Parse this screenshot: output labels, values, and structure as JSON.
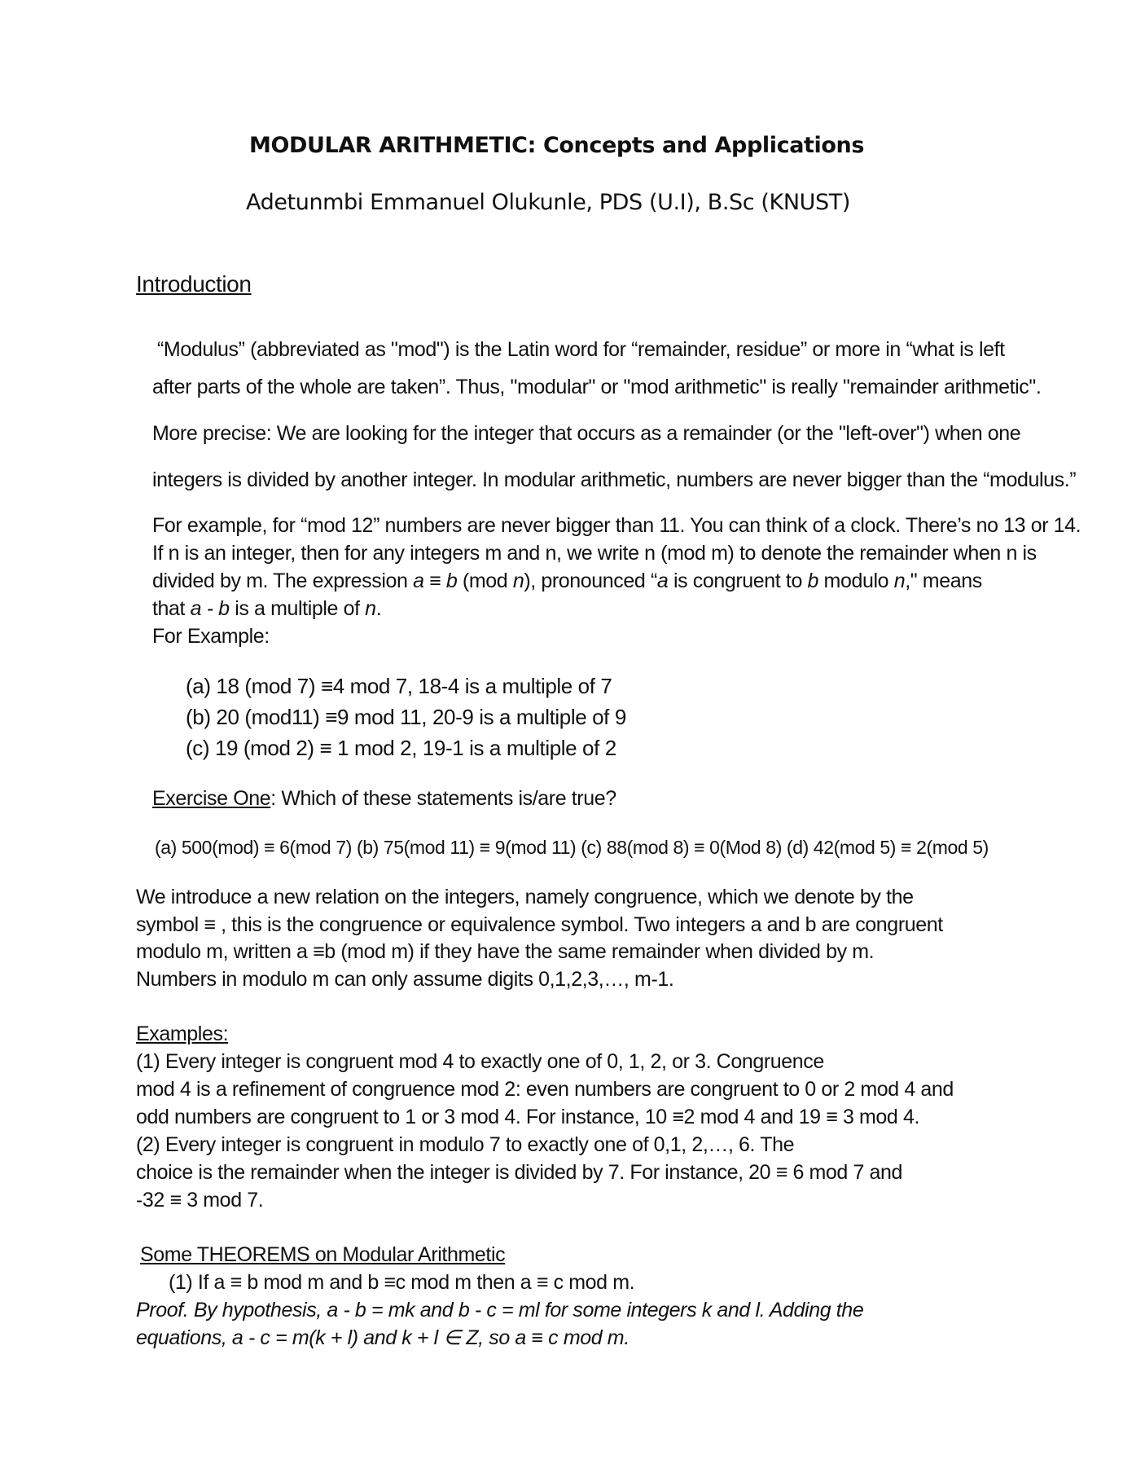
{
  "title": "MODULAR ARITHMETIC: Concepts and Applications",
  "author": "Adetunmbi Emmanuel Olukunle, PDS (U.I), B.Sc (KNUST)",
  "intro": {
    "heading": "Introduction",
    "lines": [
      "“Modulus” (abbreviated as \"mod\") is the Latin word for “remainder, residue” or more in “what is left",
      "after parts of the whole are taken”. Thus, \"modular\" or \"mod arithmetic\" is really \"remainder arithmetic\".",
      "More precise:  We are looking for the integer that occurs as a remainder (or the \"left-over\") when one",
      " integers is divided by another integer.  In modular arithmetic, numbers are never bigger than the “modulus.”",
      "For example, for “mod 12” numbers are never bigger than 11. You can think of a clock. There’s no 13 or 14.",
      "If n is an integer, then for any integers m and n, we write n (mod m) to denote the remainder when n is"
    ],
    "expr_line": {
      "pre": " divided by m. The expression ",
      "a": "a",
      "eq": " ≡ ",
      "b": "b",
      "mod_open": " (mod ",
      "n": "n",
      "mid": "), pronounced “",
      "a2": "a",
      "mid2": " is congruent to ",
      "b2": "b",
      "mid3": " modulo ",
      "n2": "n",
      "post": ",\" means"
    },
    "that_line": {
      "pre": "that  ",
      "ab": "a - b",
      "mid": " is a multiple of ",
      "n": "n",
      "post": "."
    },
    "for_example": "For Example:",
    "examples": [
      "(a) 18 (mod 7) ≡4 mod 7, 18-4 is a multiple of 7",
      "(b) 20 (mod11) ≡9 mod 11, 20-9 is a multiple of 9",
      "(c) 19 (mod 2) ≡ 1 mod 2, 19-1 is a multiple of 2"
    ]
  },
  "exercise": {
    "label": "Exercise One",
    "question": ": Which of these statements is/are true?",
    "options": "(a)  500(mod) ≡ 6(mod 7)   (b)  75(mod 11) ≡ 9(mod 11)  (c)  88(mod 8) ≡ 0(Mod 8) (d) 42(mod 5) ≡ 2(mod 5)"
  },
  "congruence": {
    "lines": [
      "We introduce a new relation on the integers, namely congruence, which we denote by the",
      "symbol ≡ , this is the congruence or equivalence symbol. Two integers a and b are congruent",
      "modulo m, written a ≡b (mod m) if they have the same remainder when divided by m.",
      "Numbers in modulo m can only assume digits 0,1,2,3,…, m-1."
    ]
  },
  "examples_section": {
    "heading": "Examples:",
    "lines": [
      "(1)  Every integer is congruent mod 4 to exactly one of 0, 1, 2, or 3. Congruence",
      "mod 4 is a refinement of congruence mod 2: even numbers are congruent to 0 or 2 mod 4 and",
      "odd numbers are congruent to 1 or 3 mod 4. For instance, 10 ≡2 mod 4 and 19 ≡ 3 mod 4.",
      " (2) Every integer is congruent in modulo 7 to exactly one of 0,1, 2,…, 6. The",
      "choice is the remainder when the integer is divided by 7. For instance, 20 ≡ 6 mod 7 and",
      "-32 ≡ 3 mod 7."
    ]
  },
  "theorems": {
    "heading": "Some THEOREMS on Modular Arithmetic",
    "theorem1": "(1)  If a ≡ b mod m and b ≡c mod m then a ≡ c mod m.",
    "proof_label": "Proof",
    "proof_line1": ". By hypothesis, a - b = mk and b - c = ml for some integers k and l. Adding the",
    "proof_line2": "equations, a - c = m(k + l) and k + l ∈ Z, so a ≡ c mod m."
  }
}
